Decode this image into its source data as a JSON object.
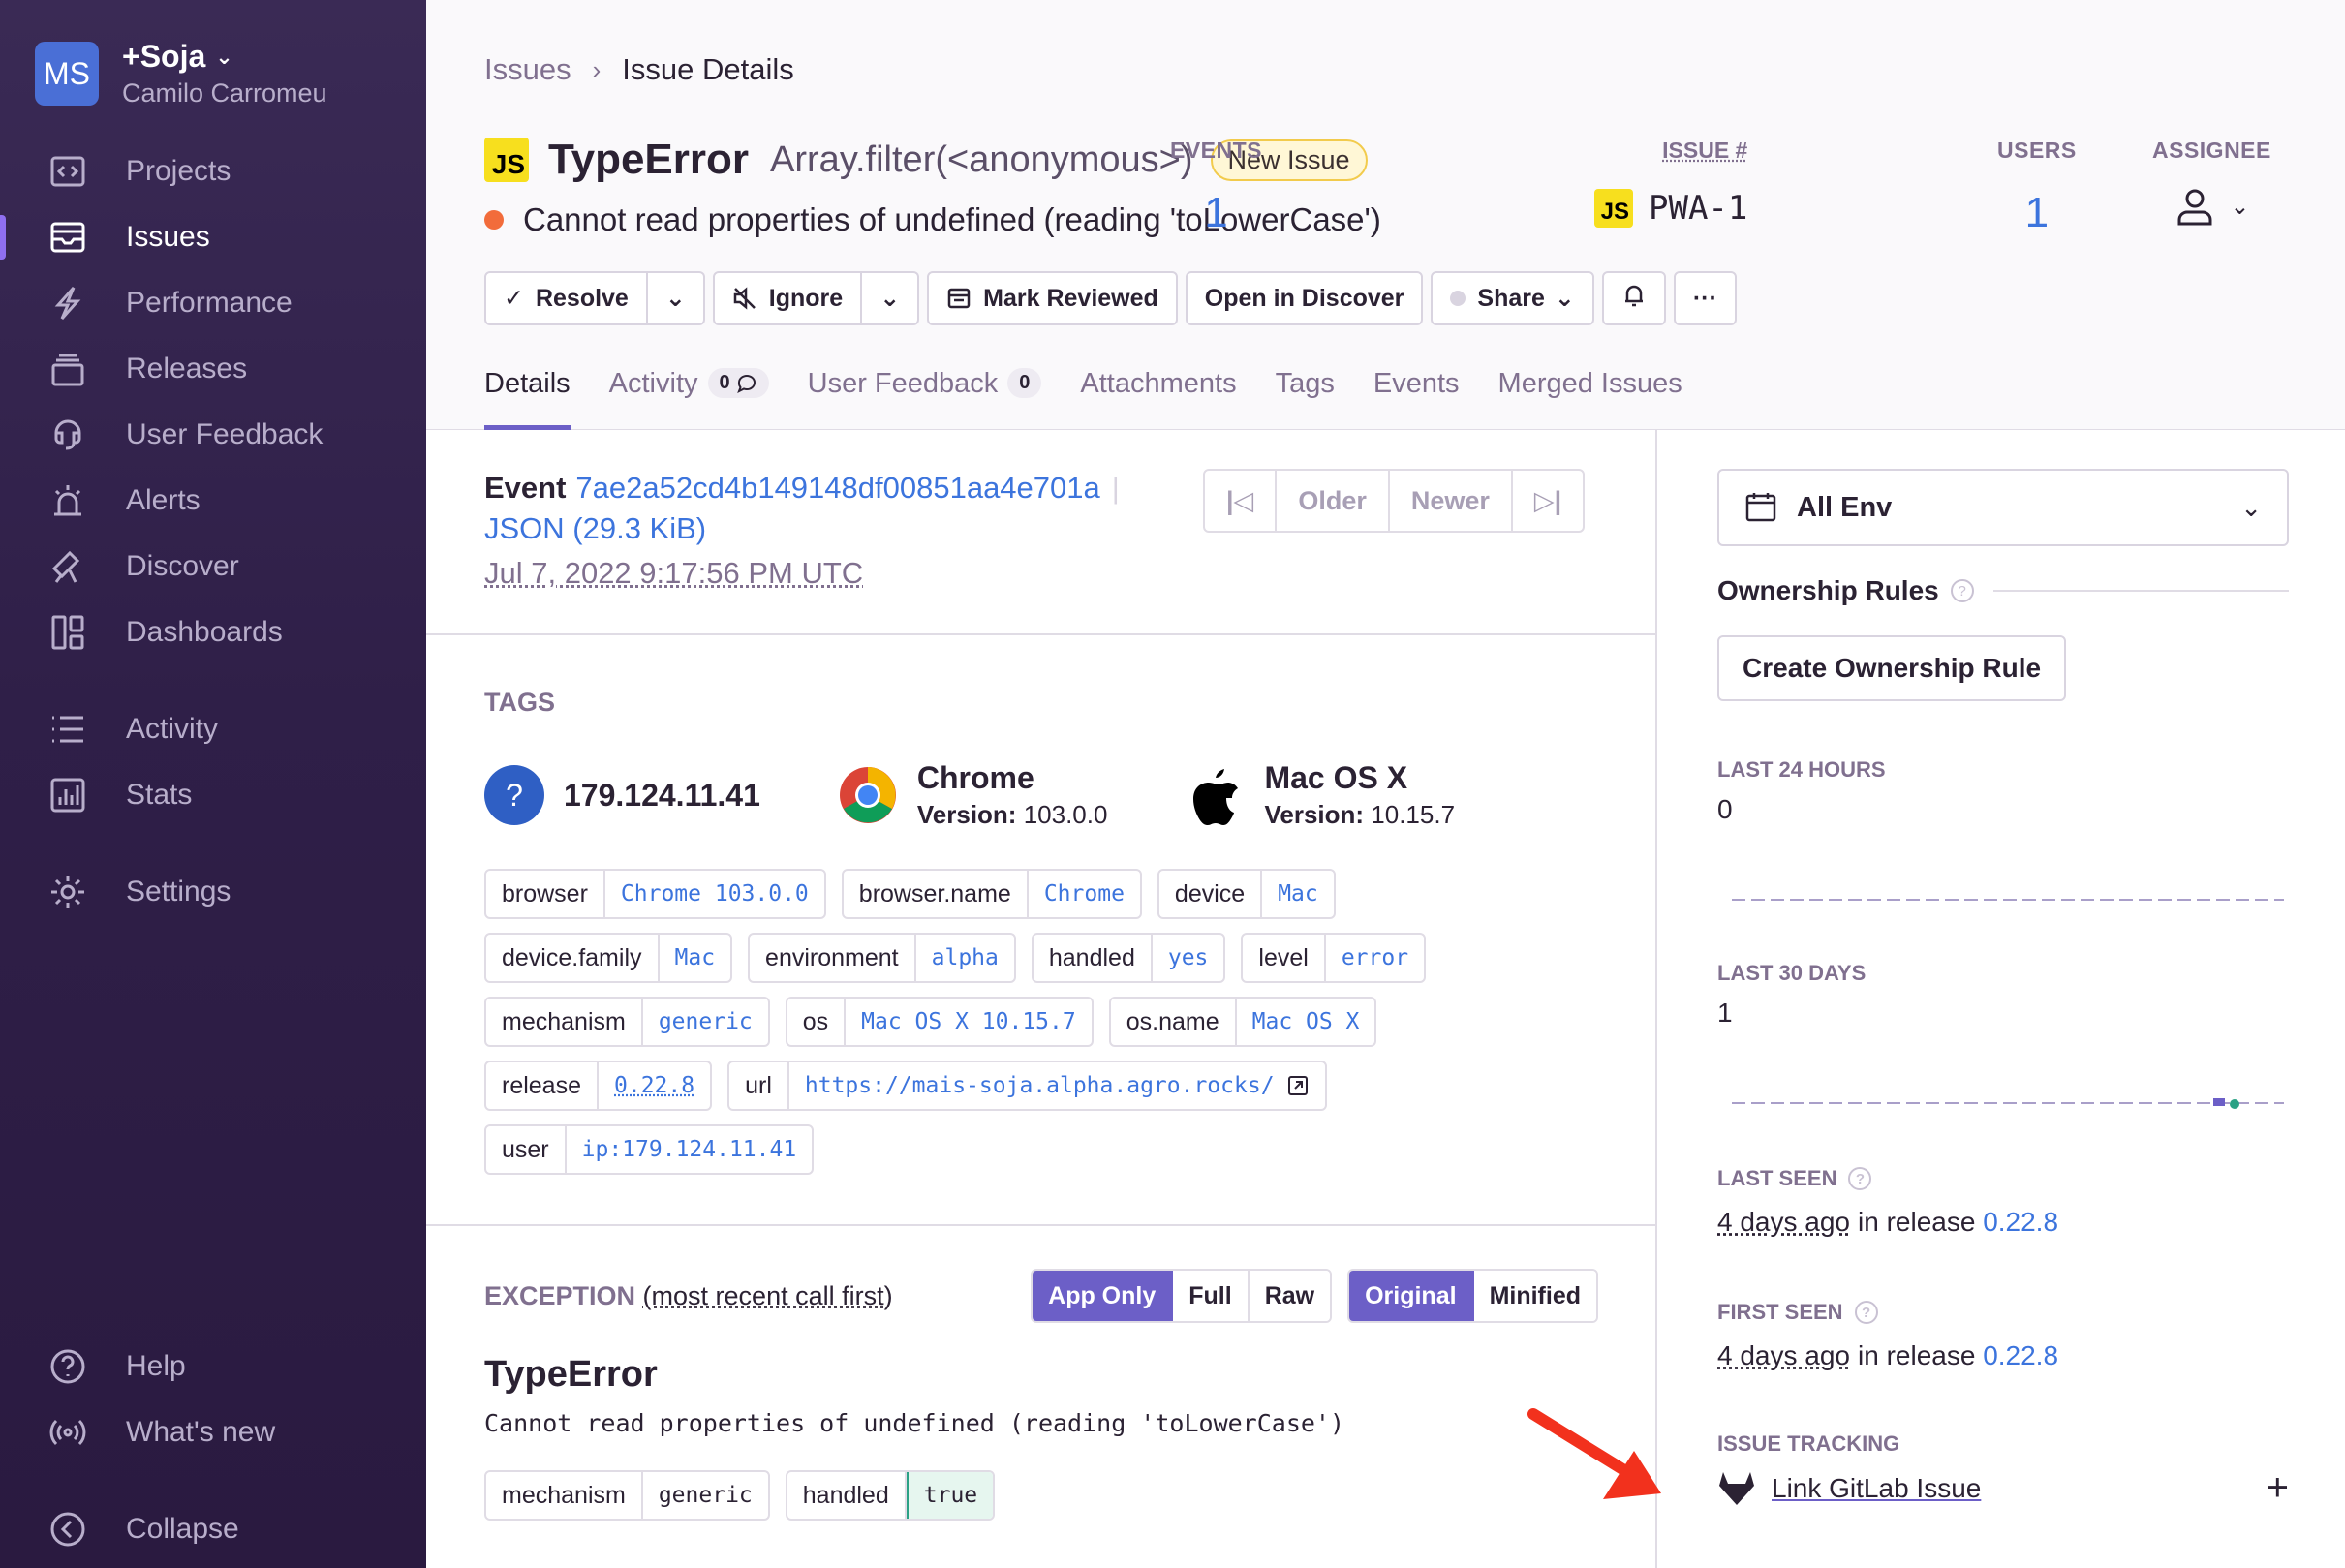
{
  "sidebar": {
    "org": {
      "avatar": "MS",
      "name": "+Soja",
      "user": "Camilo Carromeu"
    },
    "items": [
      {
        "label": "Projects",
        "icon": "projects-icon"
      },
      {
        "label": "Issues",
        "icon": "issues-icon",
        "active": true
      },
      {
        "label": "Performance",
        "icon": "performance-icon"
      },
      {
        "label": "Releases",
        "icon": "releases-icon"
      },
      {
        "label": "User Feedback",
        "icon": "user-feedback-icon"
      },
      {
        "label": "Alerts",
        "icon": "alerts-icon"
      },
      {
        "label": "Discover",
        "icon": "discover-icon"
      },
      {
        "label": "Dashboards",
        "icon": "dashboards-icon"
      },
      {
        "label": "Activity",
        "icon": "activity-icon"
      },
      {
        "label": "Stats",
        "icon": "stats-icon"
      },
      {
        "label": "Settings",
        "icon": "settings-icon"
      }
    ],
    "footer": [
      {
        "label": "Help",
        "icon": "help-icon"
      },
      {
        "label": "What's new",
        "icon": "broadcast-icon"
      },
      {
        "label": "Collapse",
        "icon": "collapse-icon"
      }
    ]
  },
  "breadcrumb": {
    "parent": "Issues",
    "current": "Issue Details"
  },
  "issue": {
    "platform_badge": "JS",
    "title": "TypeError",
    "subtitle": "Array.filter(<anonymous>)",
    "status_badge": "New Issue",
    "message": "Cannot read properties of undefined (reading 'toLowerCase')",
    "issue_label": "ISSUE #",
    "issue_code": "PWA-1",
    "events_label": "EVENTS",
    "events": "1",
    "users_label": "USERS",
    "users": "1",
    "assignee_label": "ASSIGNEE"
  },
  "actions": {
    "resolve": "Resolve",
    "ignore": "Ignore",
    "mark_reviewed": "Mark Reviewed",
    "open_discover": "Open in Discover",
    "share": "Share",
    "more": "···"
  },
  "tabs": [
    {
      "label": "Details",
      "active": true
    },
    {
      "label": "Activity",
      "count": "0"
    },
    {
      "label": "User Feedback",
      "count": "0"
    },
    {
      "label": "Attachments"
    },
    {
      "label": "Tags"
    },
    {
      "label": "Events"
    },
    {
      "label": "Merged Issues"
    }
  ],
  "event": {
    "label": "Event",
    "id": "7ae2a52cd4b149148df00851aa4e701a",
    "json": "JSON (29.3 KiB)",
    "date": "Jul 7, 2022 9:17:56 PM UTC",
    "older": "Older",
    "newer": "Newer"
  },
  "tags": {
    "title": "TAGS",
    "highlights": {
      "ip": "179.124.11.41",
      "browser_name": "Chrome",
      "browser_version_label": "Version:",
      "browser_version": "103.0.0",
      "os_name": "Mac OS X",
      "os_version_label": "Version:",
      "os_version": "10.15.7"
    },
    "rows": [
      [
        {
          "k": "browser",
          "v": "Chrome 103.0.0"
        },
        {
          "k": "browser.name",
          "v": "Chrome"
        },
        {
          "k": "device",
          "v": "Mac"
        }
      ],
      [
        {
          "k": "device.family",
          "v": "Mac"
        },
        {
          "k": "environment",
          "v": "alpha"
        },
        {
          "k": "handled",
          "v": "yes"
        },
        {
          "k": "level",
          "v": "error"
        }
      ],
      [
        {
          "k": "mechanism",
          "v": "generic"
        },
        {
          "k": "os",
          "v": "Mac OS X 10.15.7"
        },
        {
          "k": "os.name",
          "v": "Mac OS X"
        }
      ],
      [
        {
          "k": "release",
          "v": "0.22.8"
        },
        {
          "k": "url",
          "v": "https://mais-soja.alpha.agro.rocks/"
        }
      ],
      [
        {
          "k": "user",
          "v": "ip:179.124.11.41"
        }
      ]
    ]
  },
  "exception": {
    "title": "EXCEPTION",
    "subtitle": "(most recent call first)",
    "seg1": [
      "App Only",
      "Full",
      "Raw"
    ],
    "seg2": [
      "Original",
      "Minified"
    ],
    "type": "TypeError",
    "message": "Cannot read properties of undefined (reading 'toLowerCase')",
    "tags": [
      {
        "k": "mechanism",
        "v": "generic"
      },
      {
        "k": "handled",
        "v": "true"
      }
    ]
  },
  "right": {
    "env": "All Env",
    "ownership_title": "Ownership Rules",
    "ownership_btn": "Create Ownership Rule",
    "last24_label": "LAST 24 HOURS",
    "last24": "0",
    "last30_label": "LAST 30 DAYS",
    "last30": "1",
    "last_seen_label": "LAST SEEN",
    "last_seen_ago": "4 days ago",
    "last_seen_in": "in release",
    "last_seen_release": "0.22.8",
    "first_seen_label": "FIRST SEEN",
    "first_seen_ago": "4 days ago",
    "first_seen_in": "in release",
    "first_seen_release": "0.22.8",
    "tracking_label": "ISSUE TRACKING",
    "tracking_link": "Link GitLab Issue"
  },
  "colors": {
    "accent": "#6c5fc7",
    "link": "#3c74dd",
    "sidebar": "#3a2a55",
    "annotation_arrow": "#f2311d"
  }
}
